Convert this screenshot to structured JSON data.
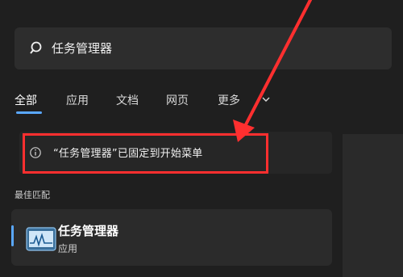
{
  "search": {
    "query": "任务管理器"
  },
  "tabs": [
    {
      "label": "全部"
    },
    {
      "label": "应用"
    },
    {
      "label": "文档"
    },
    {
      "label": "网页"
    },
    {
      "label": "更多"
    }
  ],
  "notice": {
    "text": "“任务管理器”已固定到开始菜单"
  },
  "best_match": {
    "label": "最佳匹配",
    "app_title": "任务管理器",
    "app_type": "应用"
  },
  "colors": {
    "accent": "#5aa8ff",
    "annotation": "#ff2f2f"
  },
  "icons": {
    "search": "search-icon",
    "info": "info-icon",
    "more": "chevron-down-icon",
    "app": "task-manager-icon"
  }
}
